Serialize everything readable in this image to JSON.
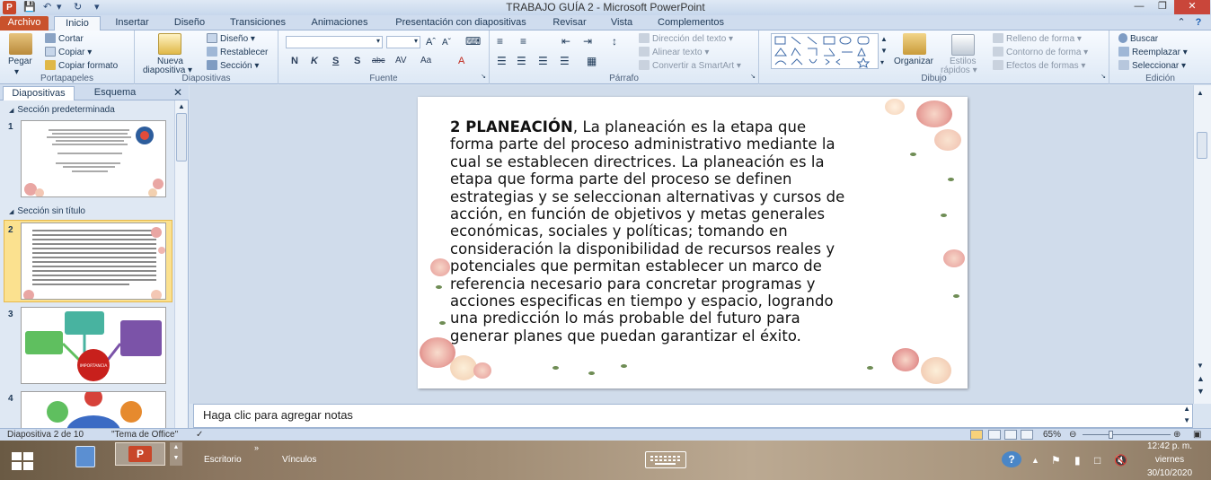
{
  "window": {
    "title": "TRABAJO GUÍA 2  -  Microsoft PowerPoint",
    "app_icon": "P"
  },
  "tabs": [
    "Archivo",
    "Inicio",
    "Insertar",
    "Diseño",
    "Transiciones",
    "Animaciones",
    "Presentación con diapositivas",
    "Revisar",
    "Vista",
    "Complementos"
  ],
  "ribbon": {
    "clipboard": {
      "label": "Portapapeles",
      "paste": "Pegar",
      "cut": "Cortar",
      "copy": "Copiar",
      "format_painter": "Copiar formato"
    },
    "slides": {
      "label": "Diapositivas",
      "new_slide_1": "Nueva",
      "new_slide_2": "diapositiva",
      "layout": "Diseño",
      "reset": "Restablecer",
      "section": "Sección"
    },
    "font": {
      "label": "Fuente"
    },
    "paragraph": {
      "label": "Párrafo",
      "text_direction": "Dirección del texto",
      "align_text": "Alinear texto",
      "smartart": "Convertir a SmartArt"
    },
    "drawing": {
      "label": "Dibujo",
      "arrange": "Organizar",
      "quick_styles_1": "Estilos",
      "quick_styles_2": "rápidos",
      "shape_fill": "Relleno de forma",
      "shape_outline": "Contorno de forma",
      "shape_effects": "Efectos de formas"
    },
    "editing": {
      "label": "Edición",
      "find": "Buscar",
      "replace": "Reemplazar",
      "select": "Seleccionar"
    }
  },
  "left_pane": {
    "tab_slides": "Diapositivas",
    "tab_outline": "Esquema",
    "section_default": "Sección predeterminada",
    "section_untitled": "Sección sin título",
    "slide_numbers": [
      "1",
      "2",
      "3",
      "4"
    ],
    "thumb3_center": "IMPORTANCIA"
  },
  "slide": {
    "heading": "2 PLANEACIÓN",
    "lines": [
      ", La planeación es la etapa que",
      "forma parte del proceso administrativo mediante la",
      "cual se establecen directrices. La planeación es la",
      "etapa que forma parte del proceso se definen",
      "estrategias y se seleccionan alternativas y cursos de",
      "acción, en función de objetivos y metas generales",
      "económicas, sociales y políticas; tomando en",
      "consideración la disponibilidad de recursos reales y",
      "potenciales que permitan establecer un marco de",
      "referencia necesario para concretar programas y",
      "acciones especificas en tiempo y espacio, logrando",
      "una predicción  lo más probable del futuro para",
      "generar planes que puedan garantizar el éxito."
    ]
  },
  "notes": {
    "placeholder": "Haga clic para agregar notas"
  },
  "status": {
    "slide_of": "Diapositiva 2 de 10",
    "theme": "\"Tema de Office\"",
    "zoom": "65%"
  },
  "taskbar": {
    "desktop": "Escritorio",
    "links": "Vínculos",
    "time": "12:42 p. m.",
    "day": "viernes",
    "date": "30/10/2020"
  },
  "colors": {
    "file_tab": "#c9522c",
    "selected_thumb": "#fbe18f",
    "close_button": "#c9463a"
  }
}
